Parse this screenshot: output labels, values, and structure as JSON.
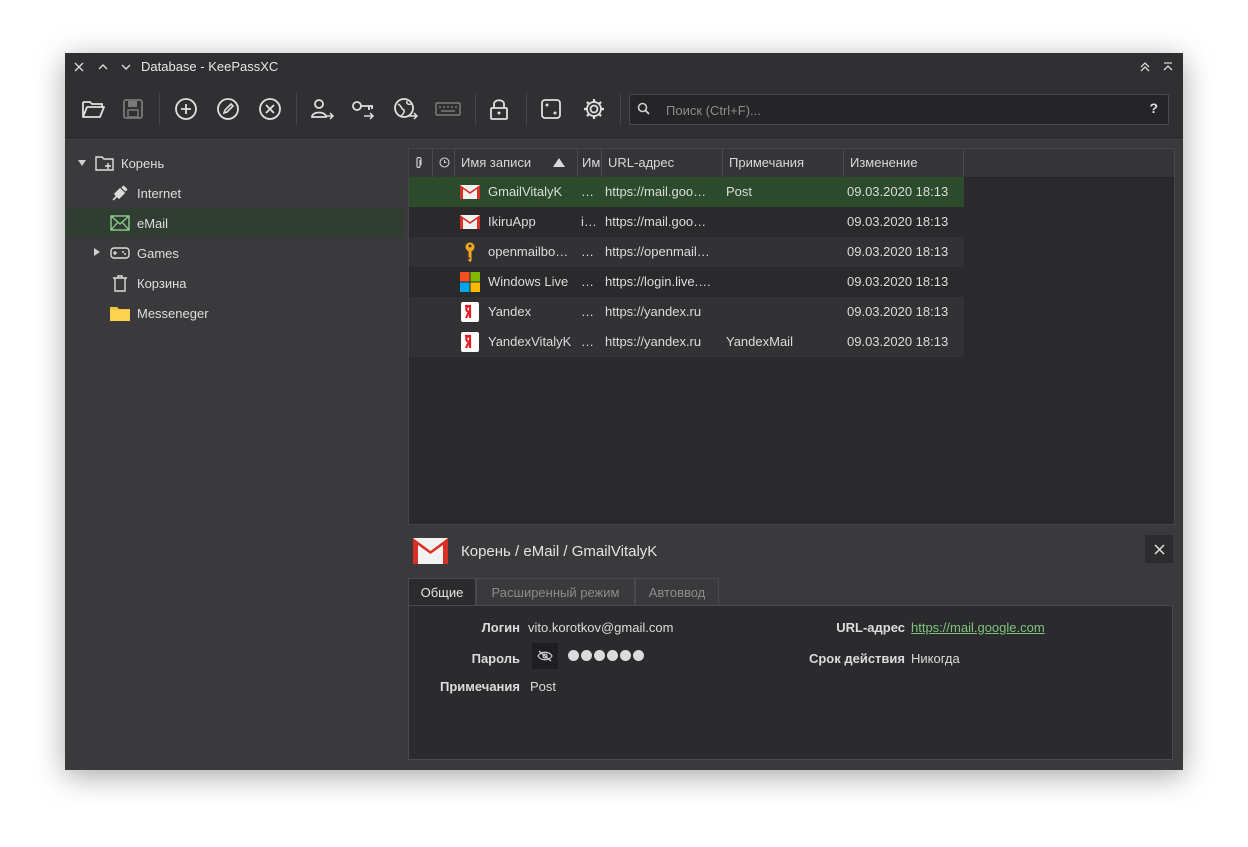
{
  "window": {
    "title": "Database - KeePassXC"
  },
  "toolbar": {
    "buttons": [
      "open-database",
      "save-database",
      "add-entry",
      "edit-entry",
      "delete-entry",
      "copy-username",
      "copy-password",
      "copy-url",
      "perform-autotype",
      "lock-database",
      "password-generator",
      "settings"
    ]
  },
  "search": {
    "placeholder": "Поиск (Ctrl+F)...",
    "help_label": "?"
  },
  "groups": [
    {
      "label": "Корень",
      "icon": "folder-icon"
    },
    {
      "label": "Internet",
      "icon": "plug-icon"
    },
    {
      "label": "eMail",
      "icon": "envelope-icon"
    },
    {
      "label": "Games",
      "icon": "gamepad-icon"
    },
    {
      "label": "Корзина",
      "icon": "trash-icon"
    },
    {
      "label": "Messeneger",
      "icon": "folder-icon"
    }
  ],
  "table": {
    "columns": [
      "Имя записи",
      "Им",
      "URL-адрес",
      "Примечания",
      "Изменение"
    ],
    "rows": [
      {
        "icon": "gmail-icon",
        "name": "GmailVitalyK",
        "user": "…",
        "url": "https://mail.goo…",
        "notes": "Post",
        "modified": "09.03.2020 18:13"
      },
      {
        "icon": "gmail-icon",
        "name": "IkiruApp",
        "user": "i…",
        "url": "https://mail.goo…",
        "notes": "",
        "modified": "09.03.2020 18:13"
      },
      {
        "icon": "key-icon",
        "name": "openmailbo…",
        "user": "…",
        "url": "https://openmail…",
        "notes": "",
        "modified": "09.03.2020 18:13"
      },
      {
        "icon": "windows-icon",
        "name": "Windows Live",
        "user": "…",
        "url": "https://login.live.…",
        "notes": "",
        "modified": "09.03.2020 18:13"
      },
      {
        "icon": "yandex-icon",
        "name": "Yandex",
        "user": "…",
        "url": "https://yandex.ru",
        "notes": "",
        "modified": "09.03.2020 18:13"
      },
      {
        "icon": "yandex-icon",
        "name": "YandexVitalyK",
        "user": "…",
        "url": "https://yandex.ru",
        "notes": "YandexMail",
        "modified": "09.03.2020 18:13"
      }
    ]
  },
  "details": {
    "path": "Корень / eMail / GmailVitalyK",
    "tabs": [
      "Общие",
      "Расширенный режим",
      "Автоввод"
    ],
    "login_label": "Логин",
    "login_value": "vito.korotkov@gmail.com",
    "password_label": "Пароль",
    "notes_label": "Примечания",
    "notes_value": "Post",
    "url_label": "URL-адрес",
    "url_value": "https://mail.google.com",
    "expiry_label": "Срок действия",
    "expiry_value": "Никогда"
  }
}
